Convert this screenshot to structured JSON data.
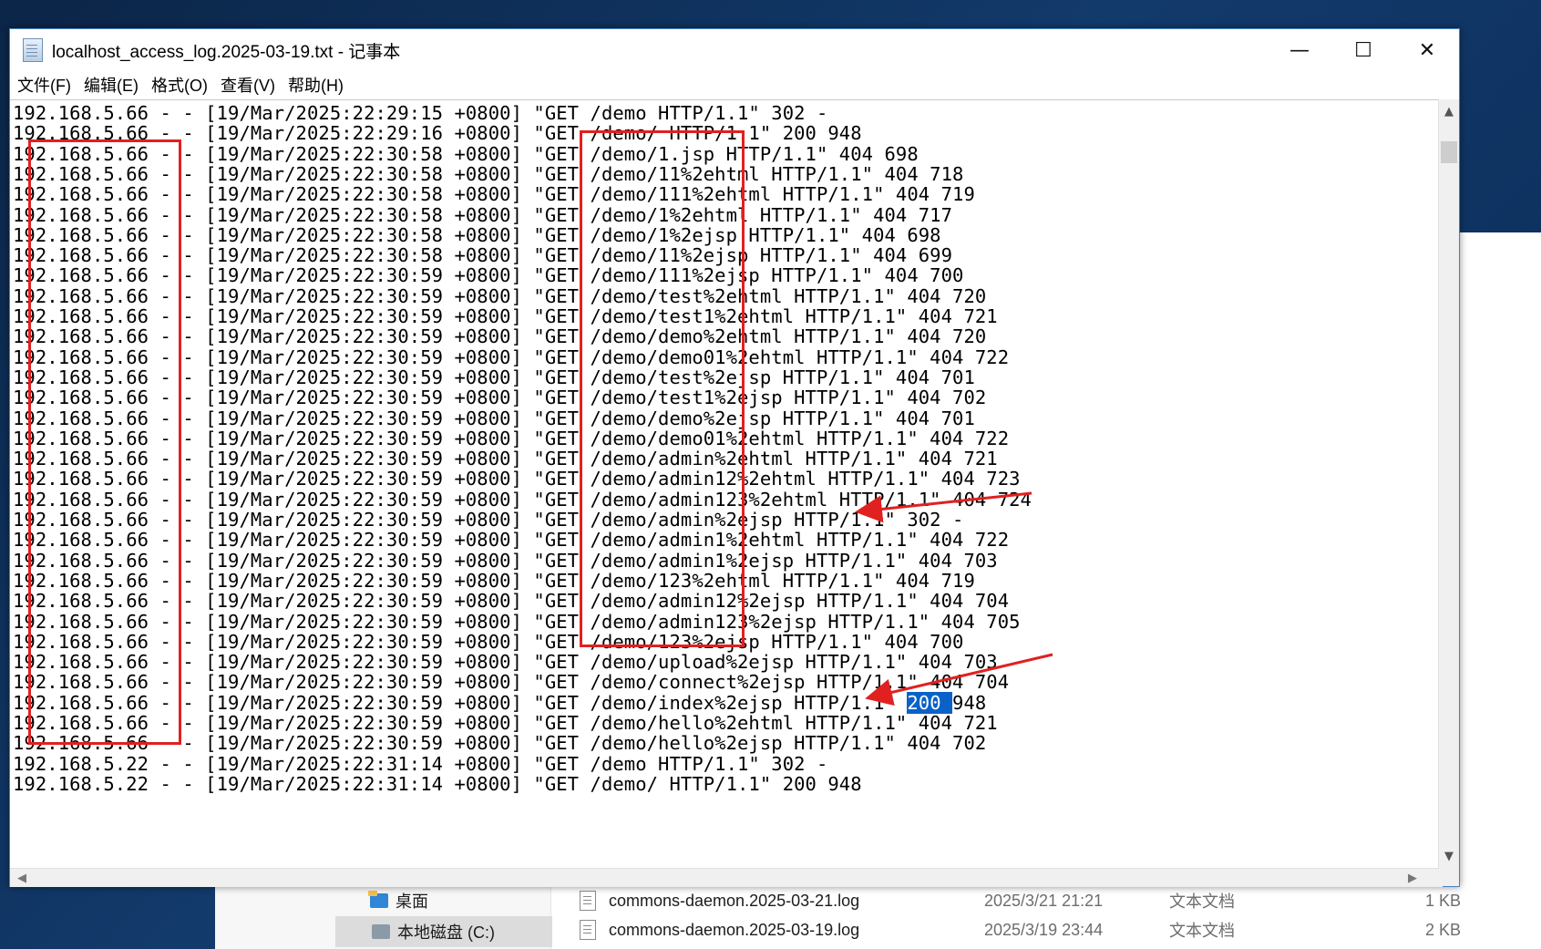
{
  "window": {
    "title": "localhost_access_log.2025-03-19.txt - 记事本",
    "controls": {
      "minimize": "—",
      "maximize": "☐",
      "close": "✕"
    }
  },
  "menu": [
    "文件(F)",
    "编辑(E)",
    "格式(O)",
    "查看(V)",
    "帮助(H)"
  ],
  "log_lines": [
    "192.168.5.66 - - [19/Mar/2025:22:29:15 +0800] \"GET /demo HTTP/1.1\" 302 -",
    "192.168.5.66 - - [19/Mar/2025:22:29:16 +0800] \"GET /demo/ HTTP/1.1\" 200 948",
    "192.168.5.66 - - [19/Mar/2025:22:30:58 +0800] \"GET /demo/1.jsp HTTP/1.1\" 404 698",
    "192.168.5.66 - - [19/Mar/2025:22:30:58 +0800] \"GET /demo/11%2ehtml HTTP/1.1\" 404 718",
    "192.168.5.66 - - [19/Mar/2025:22:30:58 +0800] \"GET /demo/111%2ehtml HTTP/1.1\" 404 719",
    "192.168.5.66 - - [19/Mar/2025:22:30:58 +0800] \"GET /demo/1%2ehtml HTTP/1.1\" 404 717",
    "192.168.5.66 - - [19/Mar/2025:22:30:58 +0800] \"GET /demo/1%2ejsp HTTP/1.1\" 404 698",
    "192.168.5.66 - - [19/Mar/2025:22:30:58 +0800] \"GET /demo/11%2ejsp HTTP/1.1\" 404 699",
    "192.168.5.66 - - [19/Mar/2025:22:30:59 +0800] \"GET /demo/111%2ejsp HTTP/1.1\" 404 700",
    "192.168.5.66 - - [19/Mar/2025:22:30:59 +0800] \"GET /demo/test%2ehtml HTTP/1.1\" 404 720",
    "192.168.5.66 - - [19/Mar/2025:22:30:59 +0800] \"GET /demo/test1%2ehtml HTTP/1.1\" 404 721",
    "192.168.5.66 - - [19/Mar/2025:22:30:59 +0800] \"GET /demo/demo%2ehtml HTTP/1.1\" 404 720",
    "192.168.5.66 - - [19/Mar/2025:22:30:59 +0800] \"GET /demo/demo01%2ehtml HTTP/1.1\" 404 722",
    "192.168.5.66 - - [19/Mar/2025:22:30:59 +0800] \"GET /demo/test%2ejsp HTTP/1.1\" 404 701",
    "192.168.5.66 - - [19/Mar/2025:22:30:59 +0800] \"GET /demo/test1%2ejsp HTTP/1.1\" 404 702",
    "192.168.5.66 - - [19/Mar/2025:22:30:59 +0800] \"GET /demo/demo%2ejsp HTTP/1.1\" 404 701",
    "192.168.5.66 - - [19/Mar/2025:22:30:59 +0800] \"GET /demo/demo01%2ehtml HTTP/1.1\" 404 722",
    "192.168.5.66 - - [19/Mar/2025:22:30:59 +0800] \"GET /demo/admin%2ehtml HTTP/1.1\" 404 721",
    "192.168.5.66 - - [19/Mar/2025:22:30:59 +0800] \"GET /demo/admin12%2ehtml HTTP/1.1\" 404 723",
    "192.168.5.66 - - [19/Mar/2025:22:30:59 +0800] \"GET /demo/admin123%2ehtml HTTP/1.1\" 404 724",
    "192.168.5.66 - - [19/Mar/2025:22:30:59 +0800] \"GET /demo/admin%2ejsp HTTP/1.1\" 302 -",
    "192.168.5.66 - - [19/Mar/2025:22:30:59 +0800] \"GET /demo/admin1%2ehtml HTTP/1.1\" 404 722",
    "192.168.5.66 - - [19/Mar/2025:22:30:59 +0800] \"GET /demo/admin1%2ejsp HTTP/1.1\" 404 703",
    "192.168.5.66 - - [19/Mar/2025:22:30:59 +0800] \"GET /demo/123%2ehtml HTTP/1.1\" 404 719",
    "192.168.5.66 - - [19/Mar/2025:22:30:59 +0800] \"GET /demo/admin12%2ejsp HTTP/1.1\" 404 704",
    "192.168.5.66 - - [19/Mar/2025:22:30:59 +0800] \"GET /demo/admin123%2ejsp HTTP/1.1\" 404 705",
    "192.168.5.66 - - [19/Mar/2025:22:30:59 +0800] \"GET /demo/123%2ejsp HTTP/1.1\" 404 700",
    "192.168.5.66 - - [19/Mar/2025:22:30:59 +0800] \"GET /demo/upload%2ejsp HTTP/1.1\" 404 703",
    "192.168.5.66 - - [19/Mar/2025:22:30:59 +0800] \"GET /demo/connect%2ejsp HTTP/1.1\" 404 704",
    "192.168.5.66 - - [19/Mar/2025:22:30:59 +0800] \"GET /demo/index%2ejsp HTTP/1.1\" 200 948",
    "192.168.5.66 - - [19/Mar/2025:22:30:59 +0800] \"GET /demo/hello%2ehtml HTTP/1.1\" 404 721",
    "192.168.5.66 - - [19/Mar/2025:22:30:59 +0800] \"GET /demo/hello%2ejsp HTTP/1.1\" 404 702",
    "192.168.5.22 - - [19/Mar/2025:22:31:14 +0800] \"GET /demo HTTP/1.1\" 302 -",
    "192.168.5.22 - - [19/Mar/2025:22:31:14 +0800] \"GET /demo/ HTTP/1.1\" 200 948"
  ],
  "selection": {
    "line": 29,
    "text": "200"
  },
  "annotation_color": "#e12020",
  "explorer": {
    "nav": [
      {
        "label": "桌面",
        "icon": "desktop-folder-icon"
      },
      {
        "label": "本地磁盘 (C:)",
        "icon": "drive-icon"
      }
    ],
    "files": [
      {
        "name": "commons-daemon.2025-03-21.log",
        "date": "2025/3/21 21:21",
        "type": "文本文档",
        "size": "1 KB"
      },
      {
        "name": "commons-daemon.2025-03-19.log",
        "date": "2025/3/19 23:44",
        "type": "文本文档",
        "size": "2 KB"
      }
    ]
  }
}
